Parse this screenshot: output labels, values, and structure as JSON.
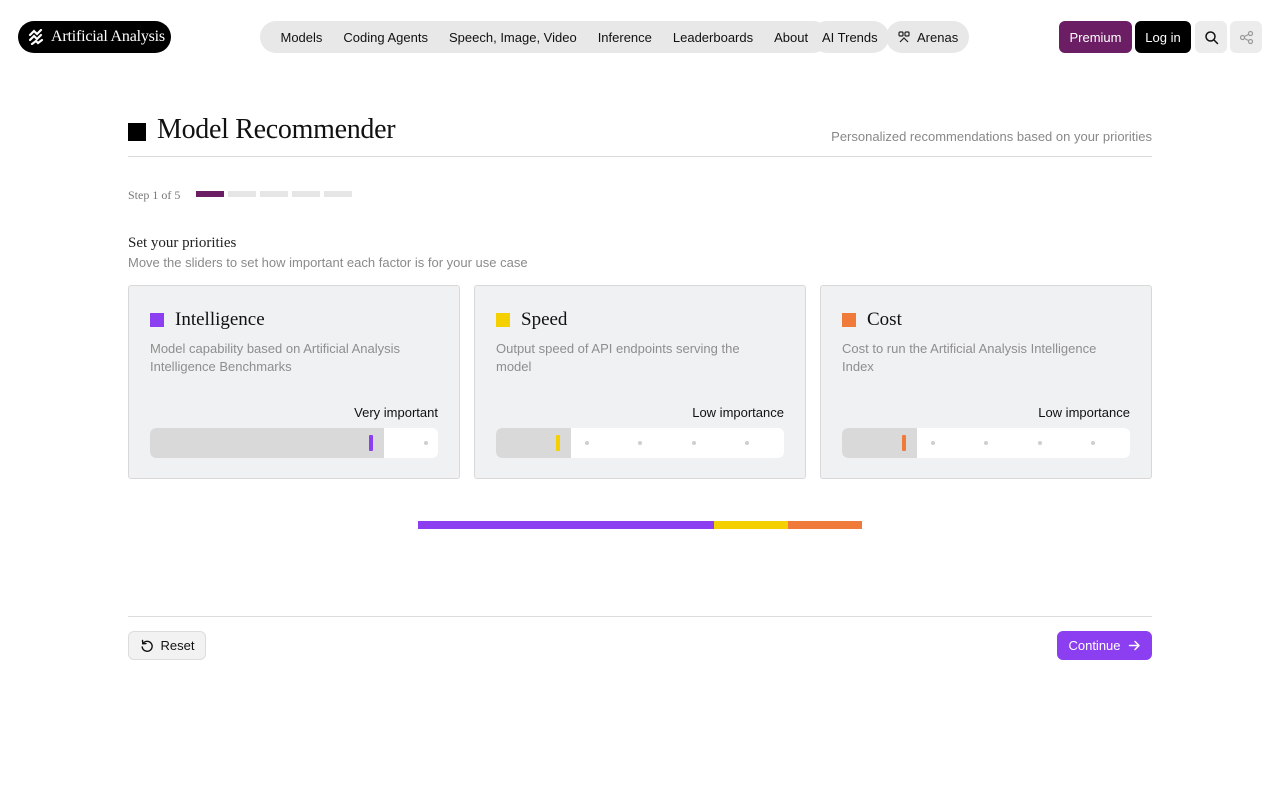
{
  "header": {
    "brand": "Artificial Analysis",
    "nav_items": [
      "Models",
      "Coding Agents",
      "Speech, Image, Video",
      "Inference",
      "Leaderboards",
      "About"
    ],
    "ai_trends": "AI Trends",
    "arenas": "Arenas",
    "premium": "Premium",
    "login": "Log in"
  },
  "page": {
    "title": "Model Recommender",
    "subtitle": "Personalized recommendations based on your priorities"
  },
  "steps": {
    "label": "Step 1 of 5",
    "current": 1,
    "total": 5
  },
  "priorities": {
    "title": "Set your priorities",
    "subtitle": "Move the sliders to set how important each factor is for your use case",
    "cards": [
      {
        "title": "Intelligence",
        "description": "Model capability based on Artificial Analysis Intelligence Benchmarks",
        "level_label": "Very important",
        "value": 4,
        "max": 5,
        "color": "#8b3ff0"
      },
      {
        "title": "Speed",
        "description": "Output speed of API endpoints serving the model",
        "level_label": "Low importance",
        "value": 1,
        "max": 5,
        "color": "#f5d000"
      },
      {
        "title": "Cost",
        "description": "Cost to run the Artificial Analysis Intelligence Index",
        "level_label": "Low importance",
        "value": 1,
        "max": 5,
        "color": "#f07a3a"
      }
    ]
  },
  "footer": {
    "reset": "Reset",
    "continue": "Continue"
  }
}
